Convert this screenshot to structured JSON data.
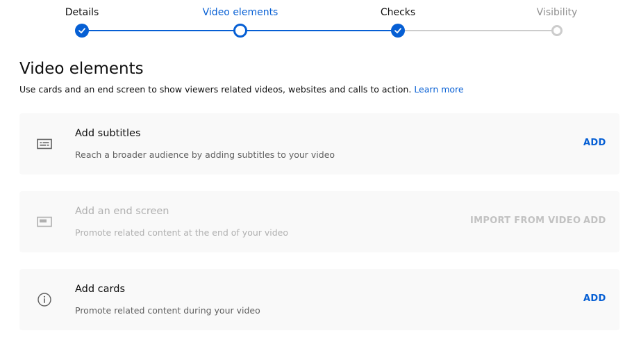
{
  "stepper": {
    "steps": [
      {
        "label": "Details",
        "state": "done"
      },
      {
        "label": "Video elements",
        "state": "current"
      },
      {
        "label": "Checks",
        "state": "done"
      },
      {
        "label": "Visibility",
        "state": "pending"
      }
    ]
  },
  "page": {
    "title": "Video elements",
    "subtitle": "Use cards and an end screen to show viewers related videos, websites and calls to action.",
    "learn_more": "Learn more"
  },
  "cards": [
    {
      "icon": "subtitles-icon",
      "title": "Add subtitles",
      "description": "Reach a broader audience by adding subtitles to your video",
      "add_label": "ADD",
      "enabled": true
    },
    {
      "icon": "end-screen-icon",
      "title": "Add an end screen",
      "description": "Promote related content at the end of your video",
      "import_label": "IMPORT FROM VIDEO",
      "add_label": "ADD",
      "enabled": false
    },
    {
      "icon": "info-icon",
      "title": "Add cards",
      "description": "Promote related content during your video",
      "add_label": "ADD",
      "enabled": true
    }
  ],
  "colors": {
    "accent": "#065fd4",
    "card_background": "#f9f9f9",
    "disabled_text": "#b0b0b0"
  }
}
